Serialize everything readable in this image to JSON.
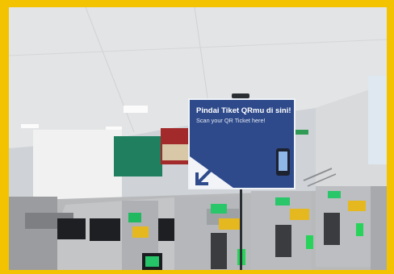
{
  "sign": {
    "title": "Pindai Tiket QRmu di sini!",
    "subtitle": "Scan your QR Ticket here!"
  },
  "colors": {
    "frame": "#f3c300",
    "sign_blue": "#2e4a8b",
    "gate_indicator": "#27d35a"
  },
  "icons": [
    "arrow-down-left-icon",
    "phone-icon"
  ]
}
